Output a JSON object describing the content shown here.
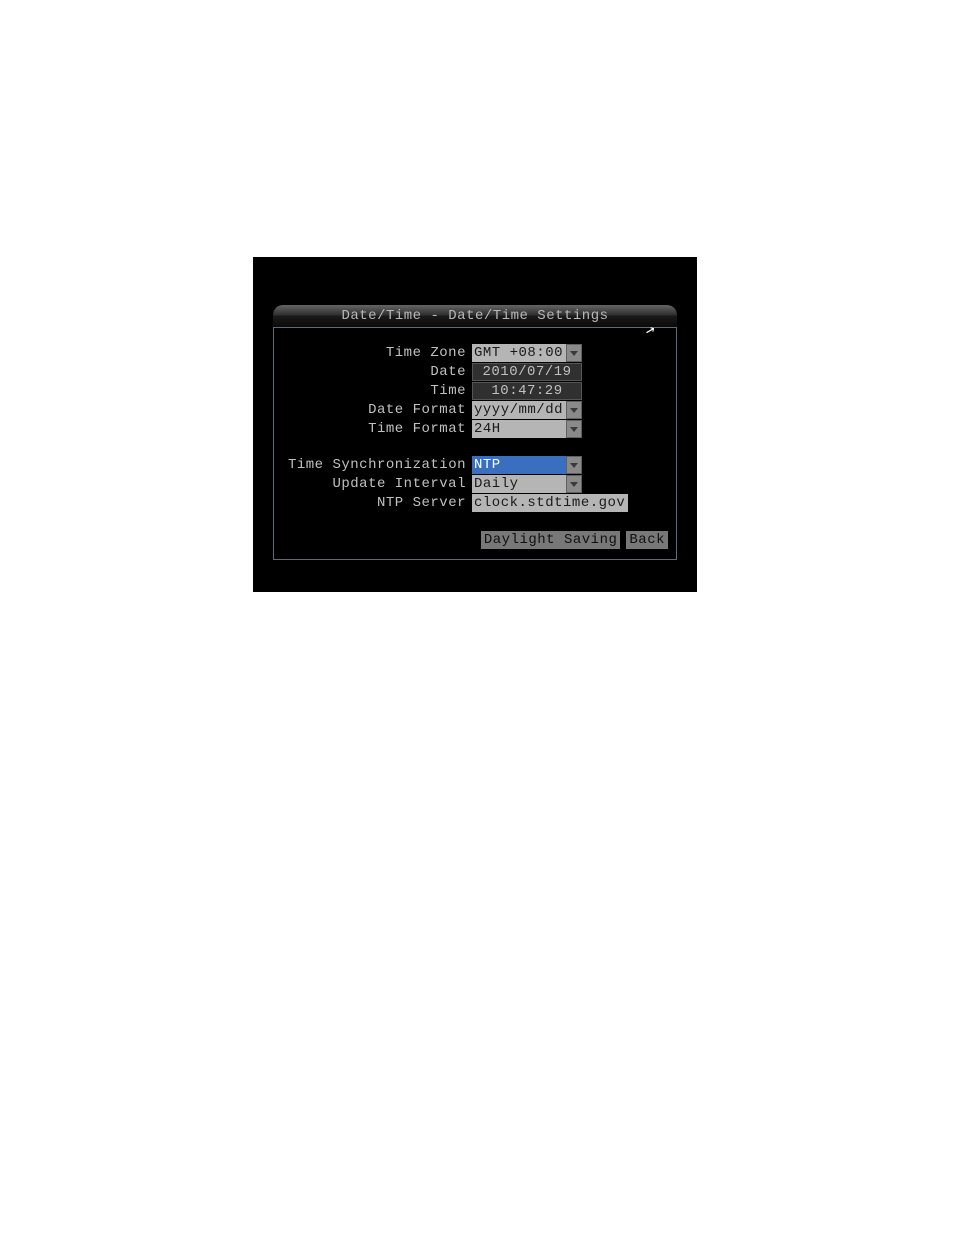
{
  "dialog": {
    "title": "Date/Time - Date/Time Settings",
    "fields": {
      "timezone": {
        "label": "Time Zone",
        "value": "GMT +08:00"
      },
      "date": {
        "label": "Date",
        "value": "2010/07/19"
      },
      "time": {
        "label": "Time",
        "value": "10:47:29"
      },
      "date_format": {
        "label": "Date Format",
        "value": "yyyy/mm/dd"
      },
      "time_format": {
        "label": "Time Format",
        "value": "24H"
      },
      "time_sync": {
        "label": "Time Synchronization",
        "value": "NTP"
      },
      "update_interval": {
        "label": "Update Interval",
        "value": "Daily"
      },
      "ntp_server": {
        "label": "NTP Server",
        "value": "clock.stdtime.gov"
      }
    },
    "buttons": {
      "daylight_saving": "Daylight Saving",
      "back": "Back"
    }
  }
}
